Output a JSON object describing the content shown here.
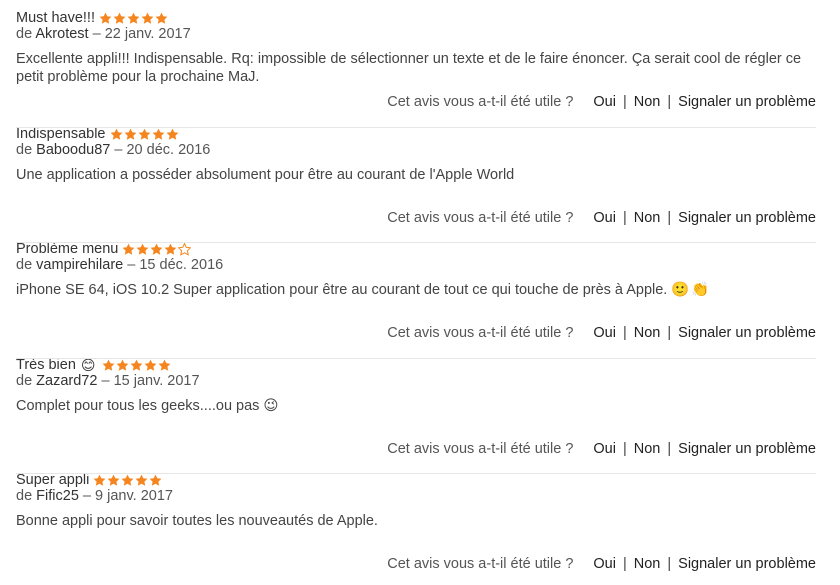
{
  "colors": {
    "star_fill": "#f5861f",
    "star_empty_stroke": "#f5861f",
    "text": "#333333",
    "divider": "#e6e6e6"
  },
  "helpful": {
    "question": "Cet avis vous a-t-il été utile ?",
    "yes": "Oui",
    "no": "Non",
    "report": "Signaler un problème",
    "separator": "|"
  },
  "reviews": [
    {
      "title": "Must have!!!",
      "title_emoji": "",
      "rating": 5,
      "prefix": "de",
      "author": "Akrotest",
      "date": "22 janv. 2017",
      "body": "Excellente appli!!! Indispensable. Rq: impossible de sélectionner un texte et de le faire énoncer. Ça serait cool de régler ce petit problème pour la prochaine MaJ.",
      "body_emojis": []
    },
    {
      "title": "Indispensable",
      "title_emoji": "",
      "rating": 5,
      "prefix": "de",
      "author": "Baboodu87",
      "date": "20 déc. 2016",
      "body": "Une application a posséder absolument pour être au courant de l'Apple World",
      "body_emojis": []
    },
    {
      "title": "Problème menu",
      "title_emoji": "",
      "rating": 4,
      "prefix": "de",
      "author": "vampirehilare",
      "date": "15 déc. 2016",
      "body": "iPhone SE 64, iOS 10.2 Super application pour être au courant de tout ce qui touche de près à Apple.",
      "body_emojis": [
        "🙂",
        "👏"
      ]
    },
    {
      "title": "Très bien",
      "title_emoji": "😊",
      "rating": 5,
      "prefix": "de",
      "author": "Zazard72",
      "date": "15 janv. 2017",
      "body": "Complet pour tous les geeks....ou pas",
      "body_emojis": [
        "😉"
      ]
    },
    {
      "title": "Super appli",
      "title_emoji": "",
      "rating": 5,
      "prefix": "de",
      "author": "Fific25",
      "date": "9 janv. 2017",
      "body": "Bonne appli pour savoir toutes les nouveautés de Apple.",
      "body_emojis": []
    }
  ]
}
